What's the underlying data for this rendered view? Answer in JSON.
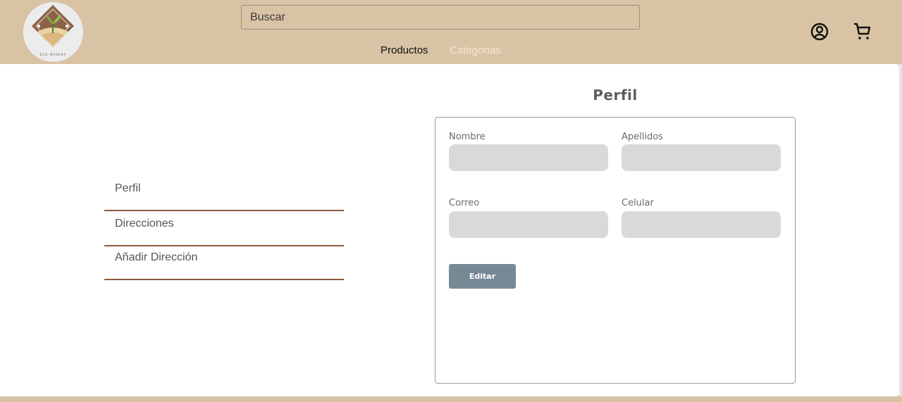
{
  "header": {
    "logo_text": "ECO MADERA",
    "search": {
      "placeholder": "Buscar",
      "value": ""
    },
    "nav": [
      {
        "label": "Productos"
      },
      {
        "label": "Categorias"
      }
    ],
    "icons": {
      "user": "user-circle-icon",
      "cart": "cart-icon"
    }
  },
  "sidebar": {
    "items": [
      {
        "label": "Perfil"
      },
      {
        "label": "Direcciones"
      },
      {
        "label": "Añadir Dirección"
      }
    ]
  },
  "profile": {
    "title": "Perfil",
    "fields": {
      "nombre": {
        "label": "Nombre",
        "value": ""
      },
      "apellidos": {
        "label": "Apellidos",
        "value": ""
      },
      "correo": {
        "label": "Correo",
        "value": ""
      },
      "celular": {
        "label": "Celular",
        "value": ""
      }
    },
    "edit_label": "Editar"
  },
  "colors": {
    "header_bg": "#d9c3a5",
    "nav_active": "#111111",
    "nav_inactive": "#f1e5d3",
    "divider": "#8a5a42",
    "input_bg": "#d9d9d9",
    "button_bg": "#768a96"
  }
}
